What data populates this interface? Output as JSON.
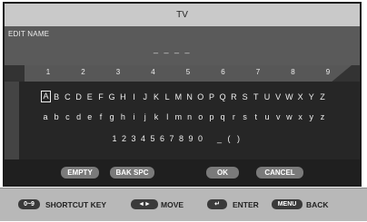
{
  "title": "TV",
  "edit_name_label": "EDIT NAME",
  "name_value": "_ _ _ _",
  "number_keys": [
    "1",
    "2",
    "3",
    "4",
    "5",
    "6",
    "7",
    "8",
    "9"
  ],
  "row_upper": [
    "A",
    "B",
    "C",
    "D",
    "E",
    "F",
    "G",
    "H",
    "I",
    "J",
    "K",
    "L",
    "M",
    "N",
    "O",
    "P",
    "Q",
    "R",
    "S",
    "T",
    "U",
    "V",
    "W",
    "X",
    "Y",
    "Z"
  ],
  "row_lower": [
    "a",
    "b",
    "c",
    "d",
    "e",
    "f",
    "g",
    "h",
    "i",
    "j",
    "k",
    "l",
    "m",
    "n",
    "o",
    "p",
    "q",
    "r",
    "s",
    "t",
    "u",
    "v",
    "w",
    "x",
    "y",
    "z"
  ],
  "row_digits": [
    "1",
    "2",
    "3",
    "4",
    "5",
    "6",
    "7",
    "8",
    "9",
    "0",
    " ",
    "_",
    "(",
    ")"
  ],
  "selected_key": "A",
  "buttons": {
    "empty": "EMPTY",
    "backspace": "BAK SPC",
    "ok": "OK",
    "cancel": "CANCEL"
  },
  "footer": {
    "shortcut_pill": "0~9",
    "shortcut_label": "SHORTCUT KEY",
    "move_pill": "◄►",
    "move_label": "MOVE",
    "enter_pill": "↵",
    "enter_label": "ENTER",
    "menu_pill": "MENU",
    "back_label": "BACK"
  }
}
